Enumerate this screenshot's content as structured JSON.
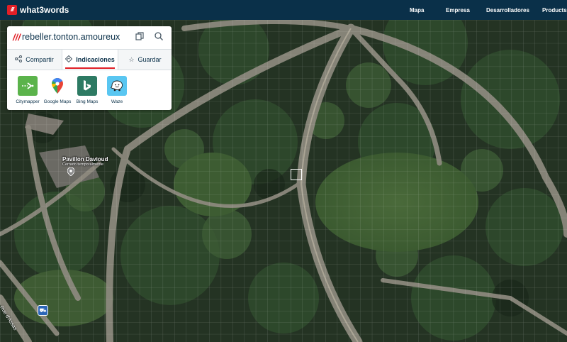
{
  "header": {
    "brand_mark": "///",
    "brand_name": "what3words",
    "nav": [
      "Mapa",
      "Empresa",
      "Desarrolladores",
      "Products"
    ]
  },
  "address_panel": {
    "prefix": "///",
    "address": "rebeller.tonton.amoureux",
    "copy_icon": "copy-icon",
    "search_icon": "search-icon",
    "tabs": [
      {
        "label": "Compartir",
        "icon": "share-icon"
      },
      {
        "label": "Indicaciones",
        "icon": "directions-icon",
        "active": true
      },
      {
        "label": "Guardar",
        "icon": "star-icon"
      }
    ],
    "apps": [
      {
        "label": "Citymapper",
        "color": "#5bb34b",
        "icon": "citymapper-icon"
      },
      {
        "label": "Google Maps",
        "color": "#ffffff",
        "icon": "google-maps-icon"
      },
      {
        "label": "Bing Maps",
        "color": "#2d7a63",
        "icon": "bing-icon"
      },
      {
        "label": "Waze",
        "color": "#59c6f1",
        "icon": "waze-icon"
      }
    ]
  },
  "map": {
    "poi": {
      "name": "Pavillon Davioud",
      "status": "Cerrado temporalmente"
    },
    "street": "Rue d'Assas",
    "accent_color": "#e11f26",
    "header_color": "#0a3049"
  }
}
